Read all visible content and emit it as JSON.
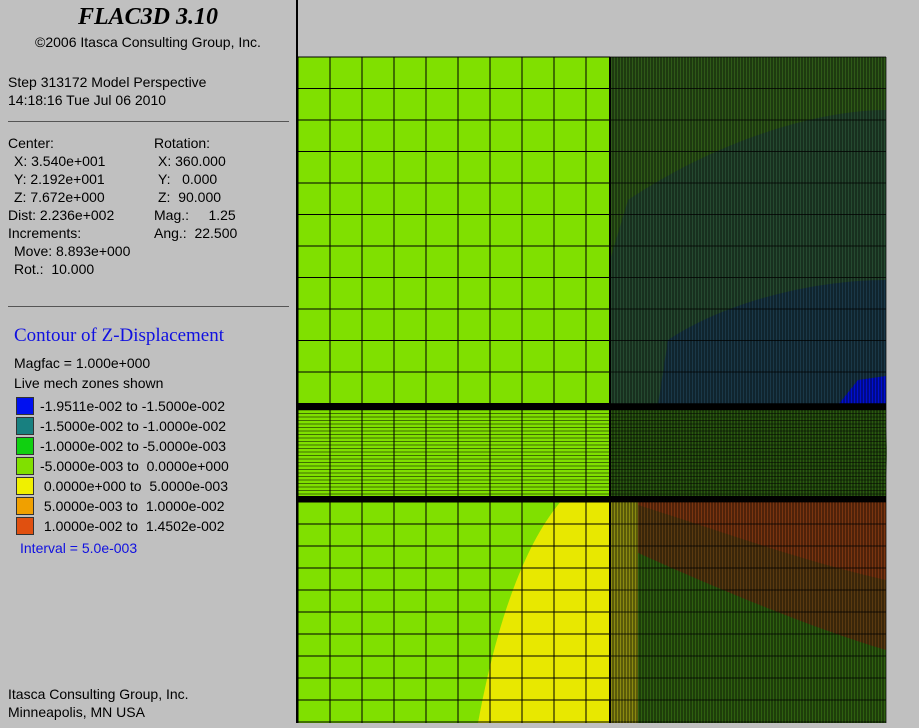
{
  "app": {
    "title": "FLAC3D 3.10",
    "copyright": "©2006 Itasca Consulting Group, Inc."
  },
  "step": {
    "line1": "Step 313172  Model Perspective",
    "line2": "14:18:16 Tue Jul 06 2010"
  },
  "view_params": {
    "center_label": "Center:",
    "rotation_label": "Rotation:",
    "cx": "X: 3.540e+001",
    "cy": "Y: 2.192e+001",
    "cz": "Z: 7.672e+000",
    "rx": "X: 360.000",
    "ry": "Y:   0.000",
    "rz": "Z:  90.000",
    "dist": "Dist: 2.236e+002",
    "mag": "Mag.:     1.25",
    "increments": "Increments:",
    "ang": "Ang.:  22.500",
    "move": "Move: 8.893e+000",
    "rot": "Rot.:  10.000"
  },
  "contour": {
    "title": "Contour of Z-Displacement",
    "magfac": "Magfac =  1.000e+000",
    "live": "Live mech zones shown",
    "interval": "Interval =  5.0e-003",
    "legend": [
      {
        "label": "-1.9511e-002 to -1.5000e-002",
        "color": "#0010f0"
      },
      {
        "label": "-1.5000e-002 to -1.0000e-002",
        "color": "#188080"
      },
      {
        "label": "-1.0000e-002 to -5.0000e-003",
        "color": "#10d010"
      },
      {
        "label": "-5.0000e-003 to  0.0000e+000",
        "color": "#80e000"
      },
      {
        "label": " 0.0000e+000 to  5.0000e-003",
        "color": "#f0f000"
      },
      {
        "label": " 5.0000e-003 to  1.0000e-002",
        "color": "#f0a000"
      },
      {
        "label": " 1.0000e-002 to  1.4502e-002",
        "color": "#e05010"
      }
    ]
  },
  "footer": {
    "line1": "Itasca Consulting Group, Inc.",
    "line2": "Minneapolis, MN  USA"
  },
  "colors": {
    "panel_bg": "#c0c0c0",
    "mesh_green": "#80e000",
    "mesh_dark": "#2a5a10",
    "mesh_blue_dark": "#1a3a40",
    "mesh_yellow": "#e8e800",
    "mesh_brown": "#7a3a10"
  }
}
